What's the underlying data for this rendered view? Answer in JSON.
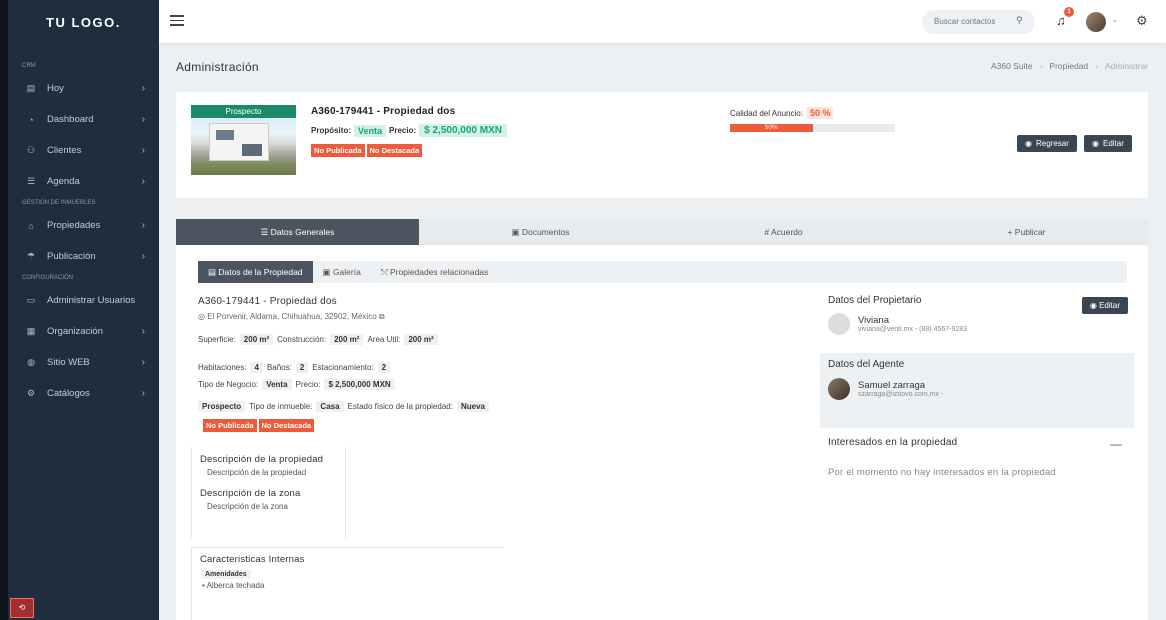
{
  "sidebar": {
    "logo": "TU LOGO.",
    "sections": [
      {
        "title": "CRM",
        "items": [
          {
            "label": "Hoy",
            "icon": "calendar-icon"
          },
          {
            "label": "Dashboard",
            "icon": "gauge-icon"
          },
          {
            "label": "Clientes",
            "icon": "users-icon"
          },
          {
            "label": "Agenda",
            "icon": "list-icon"
          }
        ]
      },
      {
        "title": "GESTION DE INMUEBLES",
        "items": [
          {
            "label": "Propiedades",
            "icon": "home-icon"
          },
          {
            "label": "Publicación",
            "icon": "broadcast-icon"
          }
        ]
      },
      {
        "title": "CONFIGURACIÓN",
        "items": [
          {
            "label": "Administrar Usuarios",
            "icon": "id-card-icon"
          },
          {
            "label": "Organización",
            "icon": "building-icon"
          },
          {
            "label": "Sitio WEB",
            "icon": "globe-icon"
          },
          {
            "label": "Catálogos",
            "icon": "gear-icon"
          }
        ]
      }
    ]
  },
  "topbar": {
    "search_placeholder": "Buscar contactos",
    "notification_count": "1"
  },
  "page": {
    "title": "Administración",
    "breadcrumb": [
      "A360 Suite",
      "Propiedad",
      "Administrar"
    ]
  },
  "summary": {
    "status_ribbon": "Prospecto",
    "property_name": "A360-179441 - Propiedad dos",
    "purpose_label": "Propósito:",
    "purpose_value": "Venta",
    "price_label": "Precio:",
    "price_value": "$ 2,500,000 MXN",
    "tags": [
      "No Publicada",
      "No Destacada"
    ],
    "quality_label": "Calidad del Anuncio:",
    "quality_value": "50 %",
    "quality_bar_text": "50%",
    "quality_fraction": 0.5,
    "btn_back": "Regresar",
    "btn_edit": "Editar"
  },
  "tabs": [
    "Datos Generales",
    "Documentos",
    "Acuerdo",
    "Publicar"
  ],
  "subtabs": [
    "Datos de la Propiedad",
    "Galería",
    "Propiedades relacionadas"
  ],
  "details": {
    "name": "A360-179441 - Propiedad dos",
    "address": "El Porvenir, Aldama, Chihuahua, 32902, México",
    "superficie_label": "Superficie:",
    "superficie": "200 m²",
    "construccion_label": "Construcción:",
    "construccion": "200 m²",
    "area_label": "Area Util:",
    "area": "200 m²",
    "habitaciones_label": "Habitaciones:",
    "habitaciones": "4",
    "banos_label": "Baños:",
    "banos": "2",
    "estac_label": "Estacionamiento:",
    "estac": "2",
    "tipo_neg_label": "Tipo de Negocio:",
    "tipo_neg": "Venta",
    "precio_label": "Precio:",
    "precio": "$ 2,500,000 MXN",
    "estado": "Prospecto",
    "tipo_inm_label": "Tipo de inmueble:",
    "tipo_inm": "Casa",
    "estado_fisico_label": "Estado físico de la propiedad:",
    "estado_fisico": "Nueva",
    "tags": [
      "No Publicada",
      "No Destacada"
    ],
    "desc_prop_title": "Descripción de la propiedad",
    "desc_prop": "Descripción de la propiedad",
    "desc_zona_title": "Descripción de la zona",
    "desc_zona": "Descripción de la zona",
    "caract_title": "Caracteristicas Internas",
    "amenidades_label": "Amenidades",
    "amenidad_1": "Alberca techada"
  },
  "owner": {
    "title": "Datos del Propietario",
    "edit": "Editar",
    "name": "Viviana",
    "contact": "viviana@venti.mx - (88) 4567-9283"
  },
  "agent": {
    "title": "Datos del Agente",
    "name": "Samuel zarraga",
    "contact": "szarraga@izoovo.com.mx -"
  },
  "interested": {
    "title": "Interesados en la propiedad",
    "empty": "Por el momento no hay interesados en la propiedad"
  }
}
